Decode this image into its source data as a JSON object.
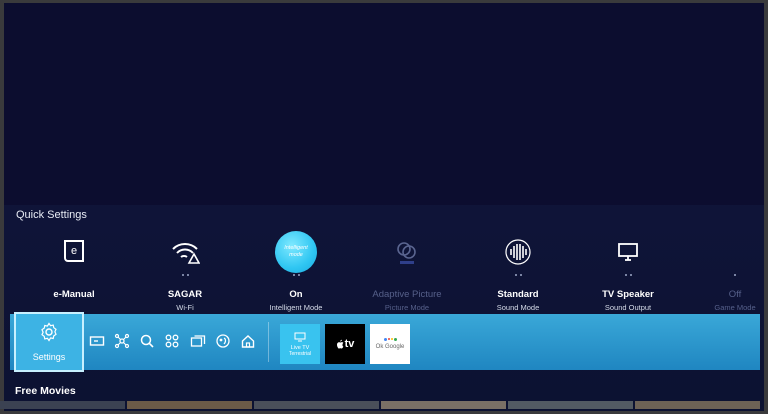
{
  "quick_settings": {
    "title": "Quick Settings",
    "items": [
      {
        "label": "e-Manual",
        "sub": "",
        "icon": "book-icon"
      },
      {
        "label": "SAGAR",
        "sub": "Wi-Fi",
        "icon": "wifi-warning-icon"
      },
      {
        "label": "On",
        "sub": "Intelligent Mode",
        "icon": "intelligent-mode-icon",
        "icon_text": "Intelligent mode"
      },
      {
        "label": "Adaptive Picture",
        "sub": "Picture Mode",
        "icon": "adaptive-picture-icon"
      },
      {
        "label": "Standard",
        "sub": "Sound Mode",
        "icon": "sound-wave-icon"
      },
      {
        "label": "TV Speaker",
        "sub": "Sound Output",
        "icon": "monitor-icon"
      },
      {
        "label": "Off",
        "sub": "Game Mode",
        "icon": ""
      }
    ]
  },
  "bar": {
    "settings_label": "Settings",
    "icons": [
      "source-icon",
      "connected-devices-icon",
      "search-icon",
      "apps-icon",
      "multiview-icon",
      "ambient-icon",
      "home-icon"
    ],
    "apps": [
      {
        "label": "Live TV",
        "sub": "Terrestrial"
      },
      {
        "label": "tv",
        "sub": ""
      },
      {
        "label": "Ok Google",
        "sub": ""
      }
    ]
  },
  "colors": {
    "background": "#0c0d2f",
    "bar": "#2b98cf",
    "accent": "#3db3e4"
  },
  "free_movies": {
    "title": "Free Movies"
  }
}
